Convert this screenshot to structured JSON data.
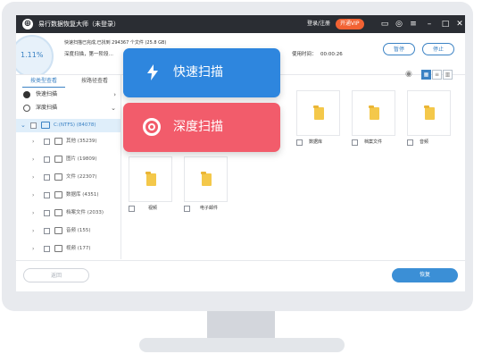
{
  "titlebar": {
    "app_title": "易行数据恢复大师（未登录）",
    "login_link": "登录/注册",
    "vip_button": "开通VIP",
    "logo": "⊕"
  },
  "header": {
    "progress": "1.11%",
    "progress_value": 1.11,
    "scan_status": "快速扫描已完成,已找到 294367 个文件 (25.8 GB)",
    "mode_text": "深度扫描，第一阶段…",
    "elapsed_label": "使用时间：",
    "elapsed_value": "00:00:26",
    "pause_button": "暂停",
    "stop_button": "停止"
  },
  "left_panel": {
    "tabs": [
      "按类型查看",
      "按路径查看"
    ],
    "menu": [
      {
        "label": "快速扫描"
      },
      {
        "label": "深度扫描"
      }
    ],
    "drive": "C:(NTFS) (84078)",
    "tree": [
      {
        "label": "其他 (35239)"
      },
      {
        "label": "图片 (19809)"
      },
      {
        "label": "文件 (22307)"
      },
      {
        "label": "数据库 (4351)"
      },
      {
        "label": "档案文件 (2033)"
      },
      {
        "label": "音频 (155)"
      },
      {
        "label": "视频 (177)"
      }
    ]
  },
  "content": {
    "tiles_row1": [
      "数据库",
      "档案文件",
      "音频"
    ],
    "tiles_row2": [
      "视频",
      "电子邮件"
    ]
  },
  "footer": {
    "back_button": "返回",
    "recover_button": "恢复"
  },
  "callouts": {
    "quick_scan": "快速扫描",
    "deep_scan": "深度扫描"
  },
  "colors": {
    "accent": "#3b82c4",
    "quick_callout": "#2e86de",
    "deep_callout": "#f25c6b",
    "vip": "#f26233",
    "titlebar": "#2a2d33"
  },
  "icons": {
    "quick_scan": "lightning-icon",
    "deep_scan": "target-icon"
  }
}
